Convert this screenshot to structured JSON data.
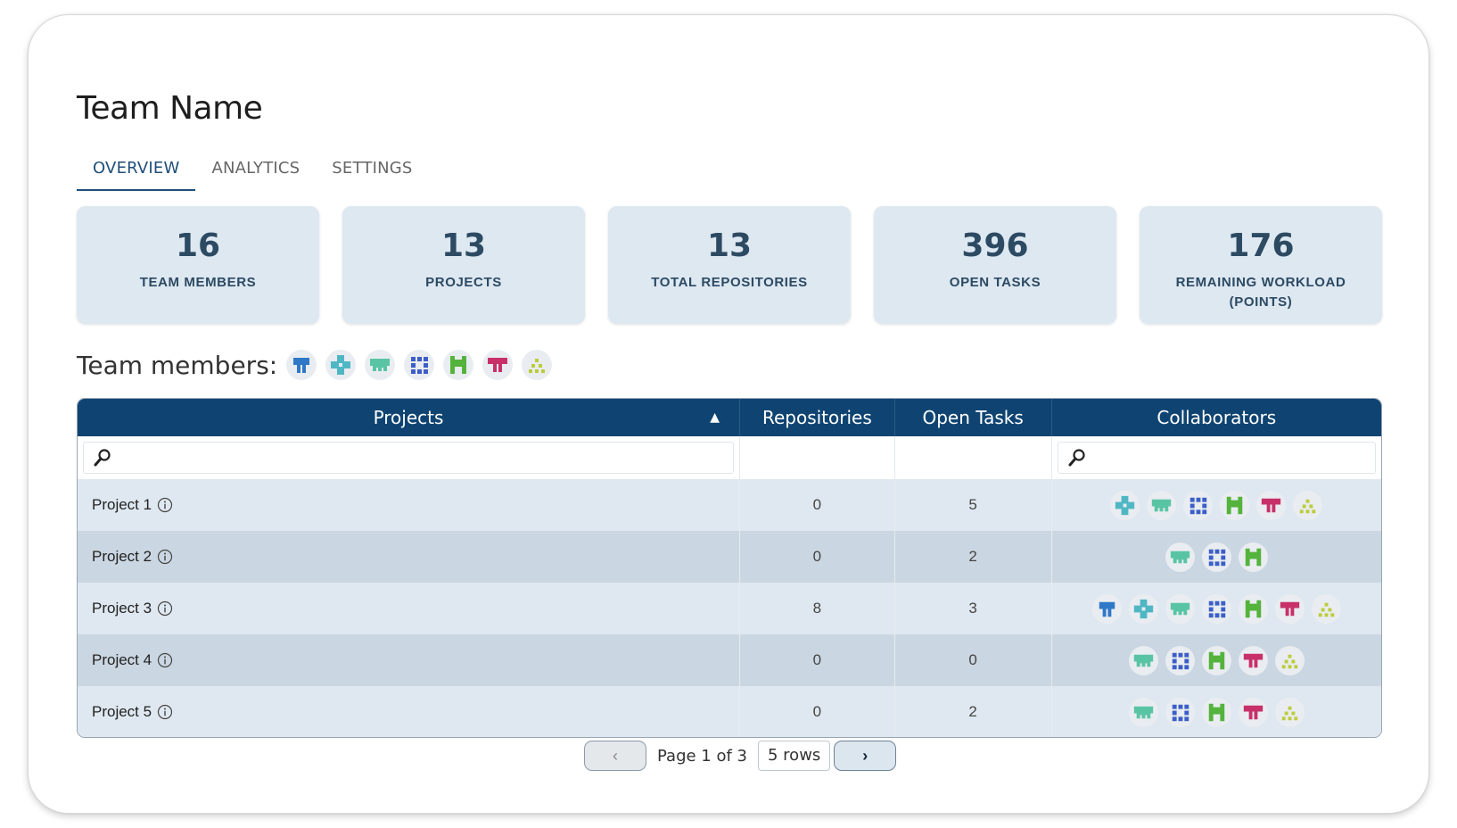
{
  "page": {
    "title": "Team Name"
  },
  "tabs": [
    {
      "label": "OVERVIEW",
      "active": true
    },
    {
      "label": "ANALYTICS",
      "active": false
    },
    {
      "label": "SETTINGS",
      "active": false
    }
  ],
  "stats": [
    {
      "value": "16",
      "label": "TEAM MEMBERS"
    },
    {
      "value": "13",
      "label": "PROJECTS"
    },
    {
      "value": "13",
      "label": "TOTAL REPOSITORIES"
    },
    {
      "value": "396",
      "label": "OPEN TASKS"
    },
    {
      "value": "176",
      "label": "REMAINING WORKLOAD (POINTS)"
    }
  ],
  "members": {
    "label": "Team members:",
    "avatars": [
      "avatar-blue",
      "avatar-teal",
      "avatar-mint",
      "avatar-navy",
      "avatar-green",
      "avatar-crimson",
      "avatar-olive"
    ]
  },
  "avatar_colors": {
    "avatar-blue": "#2f78c8",
    "avatar-teal": "#4fb7c4",
    "avatar-mint": "#59c4a4",
    "avatar-navy": "#3c5ec8",
    "avatar-green": "#54b33c",
    "avatar-crimson": "#c8306a",
    "avatar-olive": "#bccc3a"
  },
  "table": {
    "headers": [
      "Projects",
      "Repositories",
      "Open Tasks",
      "Collaborators"
    ],
    "sort_indicator": "▲",
    "project_filter_placeholder": "",
    "collab_filter_placeholder": "",
    "rows": [
      {
        "name": "Project 1",
        "repositories": "0",
        "open_tasks": "5",
        "collaborators": [
          "avatar-teal",
          "avatar-mint",
          "avatar-navy",
          "avatar-green",
          "avatar-crimson",
          "avatar-olive"
        ]
      },
      {
        "name": "Project 2",
        "repositories": "0",
        "open_tasks": "2",
        "collaborators": [
          "avatar-mint",
          "avatar-navy",
          "avatar-green"
        ]
      },
      {
        "name": "Project 3",
        "repositories": "8",
        "open_tasks": "3",
        "collaborators": [
          "avatar-blue",
          "avatar-teal",
          "avatar-mint",
          "avatar-navy",
          "avatar-green",
          "avatar-crimson",
          "avatar-olive"
        ]
      },
      {
        "name": "Project 4",
        "repositories": "0",
        "open_tasks": "0",
        "collaborators": [
          "avatar-mint",
          "avatar-navy",
          "avatar-green",
          "avatar-crimson",
          "avatar-olive"
        ]
      },
      {
        "name": "Project 5",
        "repositories": "0",
        "open_tasks": "2",
        "collaborators": [
          "avatar-mint",
          "avatar-navy",
          "avatar-green",
          "avatar-crimson",
          "avatar-olive"
        ]
      }
    ]
  },
  "pagination": {
    "prev": "‹",
    "next": "›",
    "page_text": "Page 1 of 3",
    "rows_text": "5 rows"
  }
}
